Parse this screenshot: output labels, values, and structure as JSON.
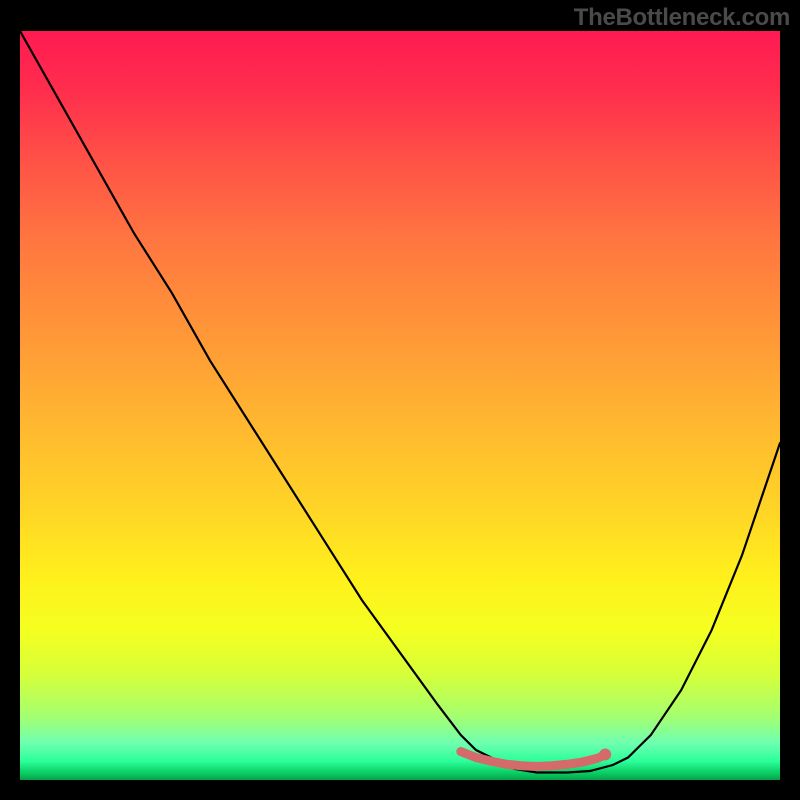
{
  "watermark": "TheBottleneck.com",
  "chart_data": {
    "type": "line",
    "title": "",
    "xlabel": "",
    "ylabel": "",
    "xlim": [
      0,
      100
    ],
    "ylim": [
      0,
      100
    ],
    "series": [
      {
        "name": "bottleneck-curve",
        "x": [
          0,
          5,
          10,
          15,
          20,
          25,
          30,
          35,
          40,
          45,
          50,
          55,
          58,
          60,
          62,
          65,
          68,
          72,
          75,
          78,
          80,
          83,
          87,
          91,
          95,
          100
        ],
        "values": [
          100,
          91,
          82,
          73,
          65,
          56,
          48,
          40,
          32,
          24,
          17,
          10,
          6,
          4,
          3,
          1.5,
          1,
          1,
          1.2,
          2,
          3,
          6,
          12,
          20,
          30,
          45
        ]
      },
      {
        "name": "highlight-segment",
        "x": [
          58,
          60,
          62,
          64,
          66,
          68,
          70,
          72,
          74,
          76,
          77
        ],
        "values": [
          3.8,
          3.0,
          2.5,
          2.1,
          1.9,
          1.8,
          1.9,
          2.1,
          2.4,
          2.9,
          3.4
        ]
      }
    ],
    "gradient": {
      "stops": [
        {
          "pos": 0.0,
          "color": "#ff1a52"
        },
        {
          "pos": 0.08,
          "color": "#ff2e4d"
        },
        {
          "pos": 0.18,
          "color": "#ff5446"
        },
        {
          "pos": 0.28,
          "color": "#ff7640"
        },
        {
          "pos": 0.4,
          "color": "#ff9638"
        },
        {
          "pos": 0.52,
          "color": "#ffb630"
        },
        {
          "pos": 0.64,
          "color": "#ffd526"
        },
        {
          "pos": 0.73,
          "color": "#fff01c"
        },
        {
          "pos": 0.8,
          "color": "#f5ff20"
        },
        {
          "pos": 0.86,
          "color": "#d5ff3a"
        },
        {
          "pos": 0.915,
          "color": "#a4ff70"
        },
        {
          "pos": 0.95,
          "color": "#70ffb0"
        },
        {
          "pos": 0.975,
          "color": "#2bff9a"
        },
        {
          "pos": 0.992,
          "color": "#08c85f"
        },
        {
          "pos": 1.0,
          "color": "#07a04d"
        }
      ]
    },
    "highlight_color": "#d46a6a",
    "curve_color": "#000000"
  }
}
